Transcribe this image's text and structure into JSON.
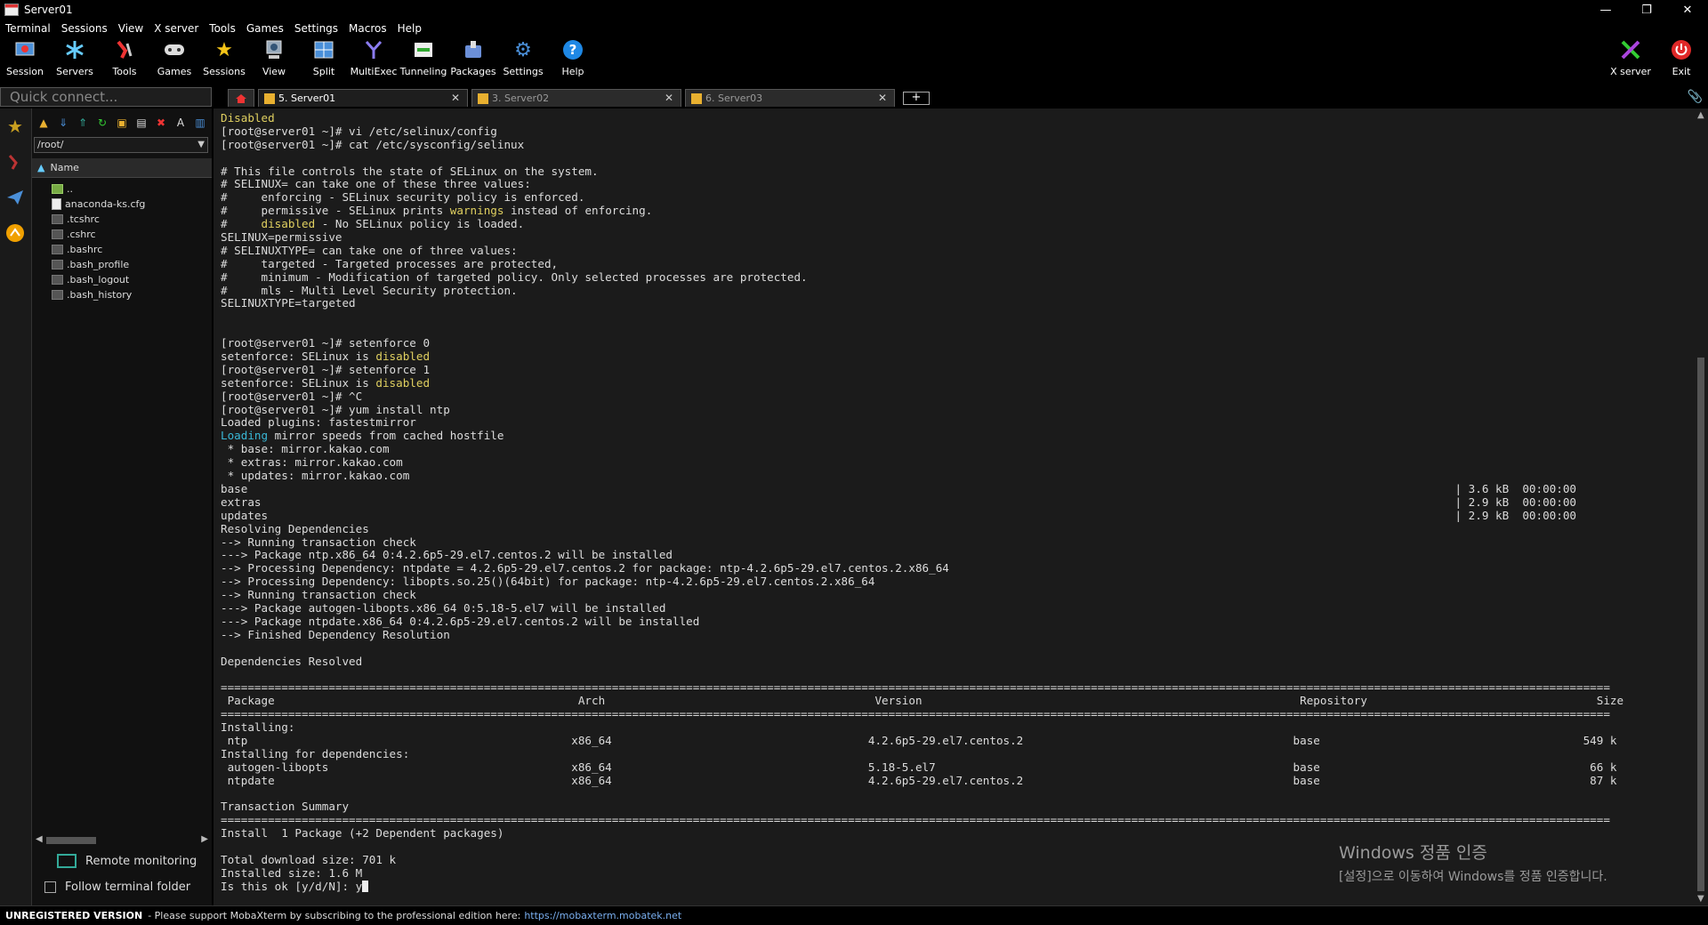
{
  "window": {
    "title": "Server01",
    "minimize": "—",
    "restore": "❐",
    "close": "✕"
  },
  "menu": [
    "Terminal",
    "Sessions",
    "View",
    "X server",
    "Tools",
    "Games",
    "Settings",
    "Macros",
    "Help"
  ],
  "toolbar": {
    "session": "Session",
    "servers": "Servers",
    "tools": "Tools",
    "games": "Games",
    "sessions": "Sessions",
    "view": "View",
    "split": "Split",
    "multiexec": "MultiExec",
    "tunneling": "Tunneling",
    "packages": "Packages",
    "settings": "Settings",
    "help": "Help",
    "xserver": "X server",
    "exit": "Exit"
  },
  "quick_connect": {
    "placeholder": "Quick connect..."
  },
  "sftp": {
    "path": "/root/",
    "column_name": "Name",
    "files": [
      "..",
      "anaconda-ks.cfg",
      ".tcshrc",
      ".cshrc",
      ".bashrc",
      ".bash_profile",
      ".bash_logout",
      ".bash_history"
    ],
    "remote_monitoring": "Remote monitoring",
    "follow_folder": "Follow terminal folder"
  },
  "tabs": [
    {
      "label": "5. Server01",
      "active": true
    },
    {
      "label": "3. Server02",
      "active": false
    },
    {
      "label": "6. Server03",
      "active": false
    }
  ],
  "terminal": {
    "lines": [
      [
        {
          "t": "Disabled",
          "c": "y"
        }
      ],
      [
        {
          "t": "[root@server01 ~]# vi /etc/selinux/config"
        }
      ],
      [
        {
          "t": "[root@server01 ~]# cat /etc/sysconfig/selinux"
        }
      ],
      [
        {
          "t": ""
        }
      ],
      [
        {
          "t": "# This file controls the state of SELinux on the system."
        }
      ],
      [
        {
          "t": "# SELINUX= can take one of these three values:"
        }
      ],
      [
        {
          "t": "#     enforcing - SELinux security policy is enforced."
        }
      ],
      [
        {
          "t": "#     permissive - SELinux prints "
        },
        {
          "t": "warnings",
          "c": "y"
        },
        {
          "t": " instead of enforcing."
        }
      ],
      [
        {
          "t": "#     "
        },
        {
          "t": "disabled",
          "c": "y"
        },
        {
          "t": " - No SELinux policy is loaded."
        }
      ],
      [
        {
          "t": "SELINUX=permissive"
        }
      ],
      [
        {
          "t": "# SELINUXTYPE= can take one of three values:"
        }
      ],
      [
        {
          "t": "#     targeted - Targeted processes are protected,"
        }
      ],
      [
        {
          "t": "#     minimum - Modification of targeted policy. Only selected processes are protected."
        }
      ],
      [
        {
          "t": "#     mls - Multi Level Security protection."
        }
      ],
      [
        {
          "t": "SELINUXTYPE=targeted"
        }
      ],
      [
        {
          "t": ""
        }
      ],
      [
        {
          "t": ""
        }
      ],
      [
        {
          "t": "[root@server01 ~]# setenforce 0"
        }
      ],
      [
        {
          "t": "setenforce: SELinux is "
        },
        {
          "t": "disabled",
          "c": "y"
        }
      ],
      [
        {
          "t": "[root@server01 ~]# setenforce 1"
        }
      ],
      [
        {
          "t": "setenforce: SELinux is "
        },
        {
          "t": "disabled",
          "c": "y"
        }
      ],
      [
        {
          "t": "[root@server01 ~]# ^C"
        }
      ],
      [
        {
          "t": "[root@server01 ~]# yum install ntp"
        }
      ],
      [
        {
          "t": "Loaded plugins: fastestmirror"
        }
      ],
      [
        {
          "t": "Loading",
          "c": "cy"
        },
        {
          "t": " mirror speeds from cached hostfile"
        }
      ],
      [
        {
          "t": " * base: mirror.kakao.com"
        }
      ],
      [
        {
          "t": " * extras: mirror.kakao.com"
        }
      ],
      [
        {
          "t": " * updates: mirror.kakao.com"
        }
      ],
      [
        {
          "t": "base                                                                                                                                                                                   | 3.6 kB  00:00:00"
        }
      ],
      [
        {
          "t": "extras                                                                                                                                                                                 | 2.9 kB  00:00:00"
        }
      ],
      [
        {
          "t": "updates                                                                                                                                                                                | 2.9 kB  00:00:00"
        }
      ],
      [
        {
          "t": "Resolving Dependencies"
        }
      ],
      [
        {
          "t": "--> Running transaction check"
        }
      ],
      [
        {
          "t": "---> Package ntp.x86_64 0:4.2.6p5-29.el7.centos.2 will be installed"
        }
      ],
      [
        {
          "t": "--> Processing Dependency: ntpdate = 4.2.6p5-29.el7.centos.2 for package: ntp-4.2.6p5-29.el7.centos.2.x86_64"
        }
      ],
      [
        {
          "t": "--> Processing Dependency: libopts.so.25()(64bit) for package: ntp-4.2.6p5-29.el7.centos.2.x86_64"
        }
      ],
      [
        {
          "t": "--> Running transaction check"
        }
      ],
      [
        {
          "t": "---> Package autogen-libopts.x86_64 0:5.18-5.el7 will be installed"
        }
      ],
      [
        {
          "t": "---> Package ntpdate.x86_64 0:4.2.6p5-29.el7.centos.2 will be installed"
        }
      ],
      [
        {
          "t": "--> Finished Dependency Resolution"
        }
      ],
      [
        {
          "t": ""
        }
      ],
      [
        {
          "t": "Dependencies Resolved"
        }
      ],
      [
        {
          "t": ""
        }
      ],
      [
        {
          "t": "=============================================================================================================================================================================================================="
        }
      ],
      [
        {
          "t": " Package                                             Arch                                        Version                                                        Repository                                  Size"
        }
      ],
      [
        {
          "t": "=============================================================================================================================================================================================================="
        }
      ],
      [
        {
          "t": "Installing:"
        }
      ],
      [
        {
          "t": " ntp                                                x86_64                                      4.2.6p5-29.el7.centos.2                                        base                                       549 k"
        }
      ],
      [
        {
          "t": "Installing for dependencies:"
        }
      ],
      [
        {
          "t": " autogen-libopts                                    x86_64                                      5.18-5.el7                                                     base                                        66 k"
        }
      ],
      [
        {
          "t": " ntpdate                                            x86_64                                      4.2.6p5-29.el7.centos.2                                        base                                        87 k"
        }
      ],
      [
        {
          "t": ""
        }
      ],
      [
        {
          "t": "Transaction Summary"
        }
      ],
      [
        {
          "t": "=============================================================================================================================================================================================================="
        }
      ],
      [
        {
          "t": "Install  1 Package (+2 Dependent packages)"
        }
      ],
      [
        {
          "t": ""
        }
      ],
      [
        {
          "t": "Total download size: 701 k"
        }
      ],
      [
        {
          "t": "Installed size: 1.6 M"
        }
      ],
      [
        {
          "t": "Is this ok [y/d/N]: y"
        },
        {
          "t": "",
          "c": "cursor"
        }
      ]
    ]
  },
  "watermark": {
    "line1": "Windows 정품 인증",
    "line2": "[설정]으로 이동하여 Windows를 정품 인증합니다."
  },
  "status": {
    "unregistered": "UNREGISTERED VERSION",
    "message": " -  Please support MobaXterm by subscribing to the professional edition here:",
    "link": "https://mobaxterm.mobatek.net"
  },
  "colors": {
    "yellow": "#e0d060",
    "cyan": "#39b7d6",
    "terminal_bg": "#1b1b1b"
  }
}
